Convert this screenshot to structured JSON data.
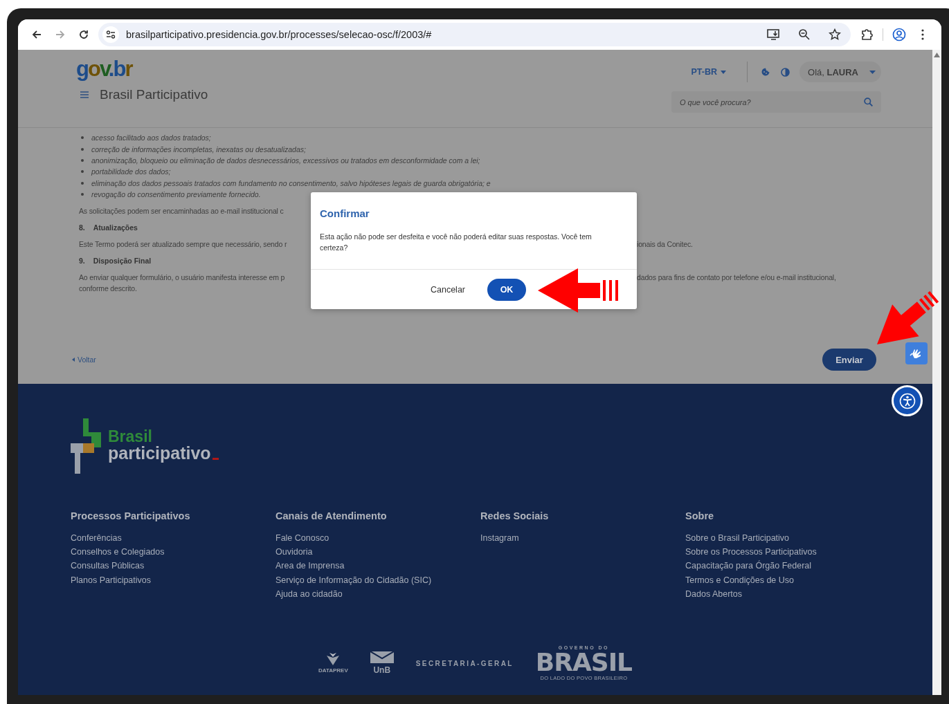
{
  "browser": {
    "url": "brasilparticipativo.presidencia.gov.br/processes/selecao-osc/f/2003/#",
    "forward": {
      "disabled": true
    }
  },
  "header": {
    "logo": "gov.br",
    "title": "Brasil Participativo",
    "language": "PT-BR",
    "greeting": "Olá, **LAURA**",
    "search": {
      "placeholder": "O que você procura?"
    }
  },
  "terms": {
    "bullets": [
      "acesso facilitado aos dados tratados;",
      "correção de informações incompletas, inexatas ou desatualizadas;",
      "anonimização, bloqueio ou eliminação de dados desnecessários, excessivos ou tratados em desconformidade com a lei;",
      "portabilidade dos dados;",
      "eliminação dos dados pessoais tratados com fundamento no consentimento, salvo hipóteses legais de guarda obrigatória; e",
      "revogação do consentimento previamente fornecido."
    ],
    "blocks": [
      {
        "kind": "paragraph",
        "lines": [
          [
            "As solicitações podem ser encaminhadas ao e-mail institucional c"
          ]
        ]
      },
      {
        "kind": "heading",
        "number": "8.",
        "text": "Atualizações"
      },
      {
        "kind": "paragraph",
        "lines": [
          [
            "Este Termo poderá ser atualizado sempre que necessário, sendo r",
            "ionais da Conitec."
          ]
        ]
      },
      {
        "kind": "heading",
        "number": "9.",
        "text": "Disposição Final"
      },
      {
        "kind": "paragraph",
        "lines": [
          [
            "Ao enviar qualquer formulário, o usuário manifesta interesse em p",
            "dados para fins de contato por telefone e/ou e-mail institucional,"
          ],
          [
            "conforme descrito."
          ]
        ]
      }
    ],
    "back": "Voltar",
    "submit": "Enviar"
  },
  "dialog": {
    "title": "Confirmar",
    "message": "Esta ação não pode ser desfeita e você não poderá editar suas respostas. Você tem certeza?",
    "buttons": [
      {
        "label": "Cancelar",
        "kind": "text"
      },
      {
        "label": "OK",
        "kind": "primary"
      }
    ]
  },
  "footer": {
    "brand": {
      "line1": "Brasil",
      "line2": "participativo"
    },
    "columns": [
      {
        "title": "Processos Participativos",
        "links": [
          "Conferências",
          "Conselhos e Colegiados",
          "Consultas Públicas",
          "Planos Participativos"
        ]
      },
      {
        "title": "Canais de Atendimento",
        "links": [
          "Fale Conosco",
          "Ouvidoria",
          "Area de Imprensa",
          "Serviço de Informação do Cidadão (SIC)",
          "Ajuda ao cidadão"
        ]
      },
      {
        "title": "Redes Sociais",
        "links": [
          "Instagram"
        ]
      },
      {
        "title": "Sobre",
        "links": [
          "Sobre o Brasil Participativo",
          "Sobre os Processos Participativos",
          "Capacitação para Órgão Federal",
          "Termos e Condições de Uso",
          "Dados Abertos"
        ]
      }
    ],
    "partners": [
      {
        "kind": "dataprev",
        "label": "DATAPREV"
      },
      {
        "kind": "unb",
        "label": "UnB"
      },
      {
        "kind": "wordmark",
        "label": "SECRETARIA-GERAL"
      },
      {
        "kind": "government",
        "top": "GOVERNO DO",
        "label": "BRASIL",
        "bottom": "DO LADO DO POVO BRASILEIRO"
      }
    ]
  }
}
